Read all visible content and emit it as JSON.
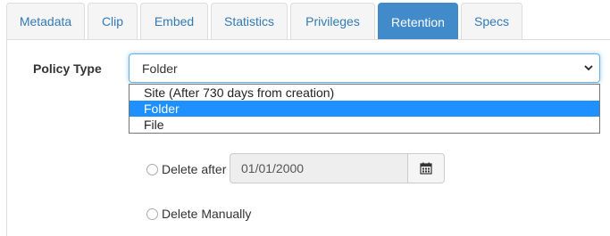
{
  "tabs": [
    {
      "label": "Metadata",
      "active": false
    },
    {
      "label": "Clip",
      "active": false
    },
    {
      "label": "Embed",
      "active": false
    },
    {
      "label": "Statistics",
      "active": false
    },
    {
      "label": "Privileges",
      "active": false
    },
    {
      "label": "Retention",
      "active": true
    },
    {
      "label": "Specs",
      "active": false
    }
  ],
  "policy": {
    "label": "Policy Type",
    "selected_value": "Folder",
    "options": [
      {
        "label": "Site (After 730 days from creation)",
        "selected": false
      },
      {
        "label": "Folder",
        "selected": true
      },
      {
        "label": "File",
        "selected": false
      }
    ]
  },
  "delete_after": {
    "label": "Delete after",
    "date_value": "01/01/2000",
    "icon": "calendar-icon"
  },
  "delete_manually": {
    "label": "Delete Manually"
  },
  "colors": {
    "active_tab": "#428bca",
    "link": "#337ab7",
    "highlight": "#1e90ff"
  }
}
